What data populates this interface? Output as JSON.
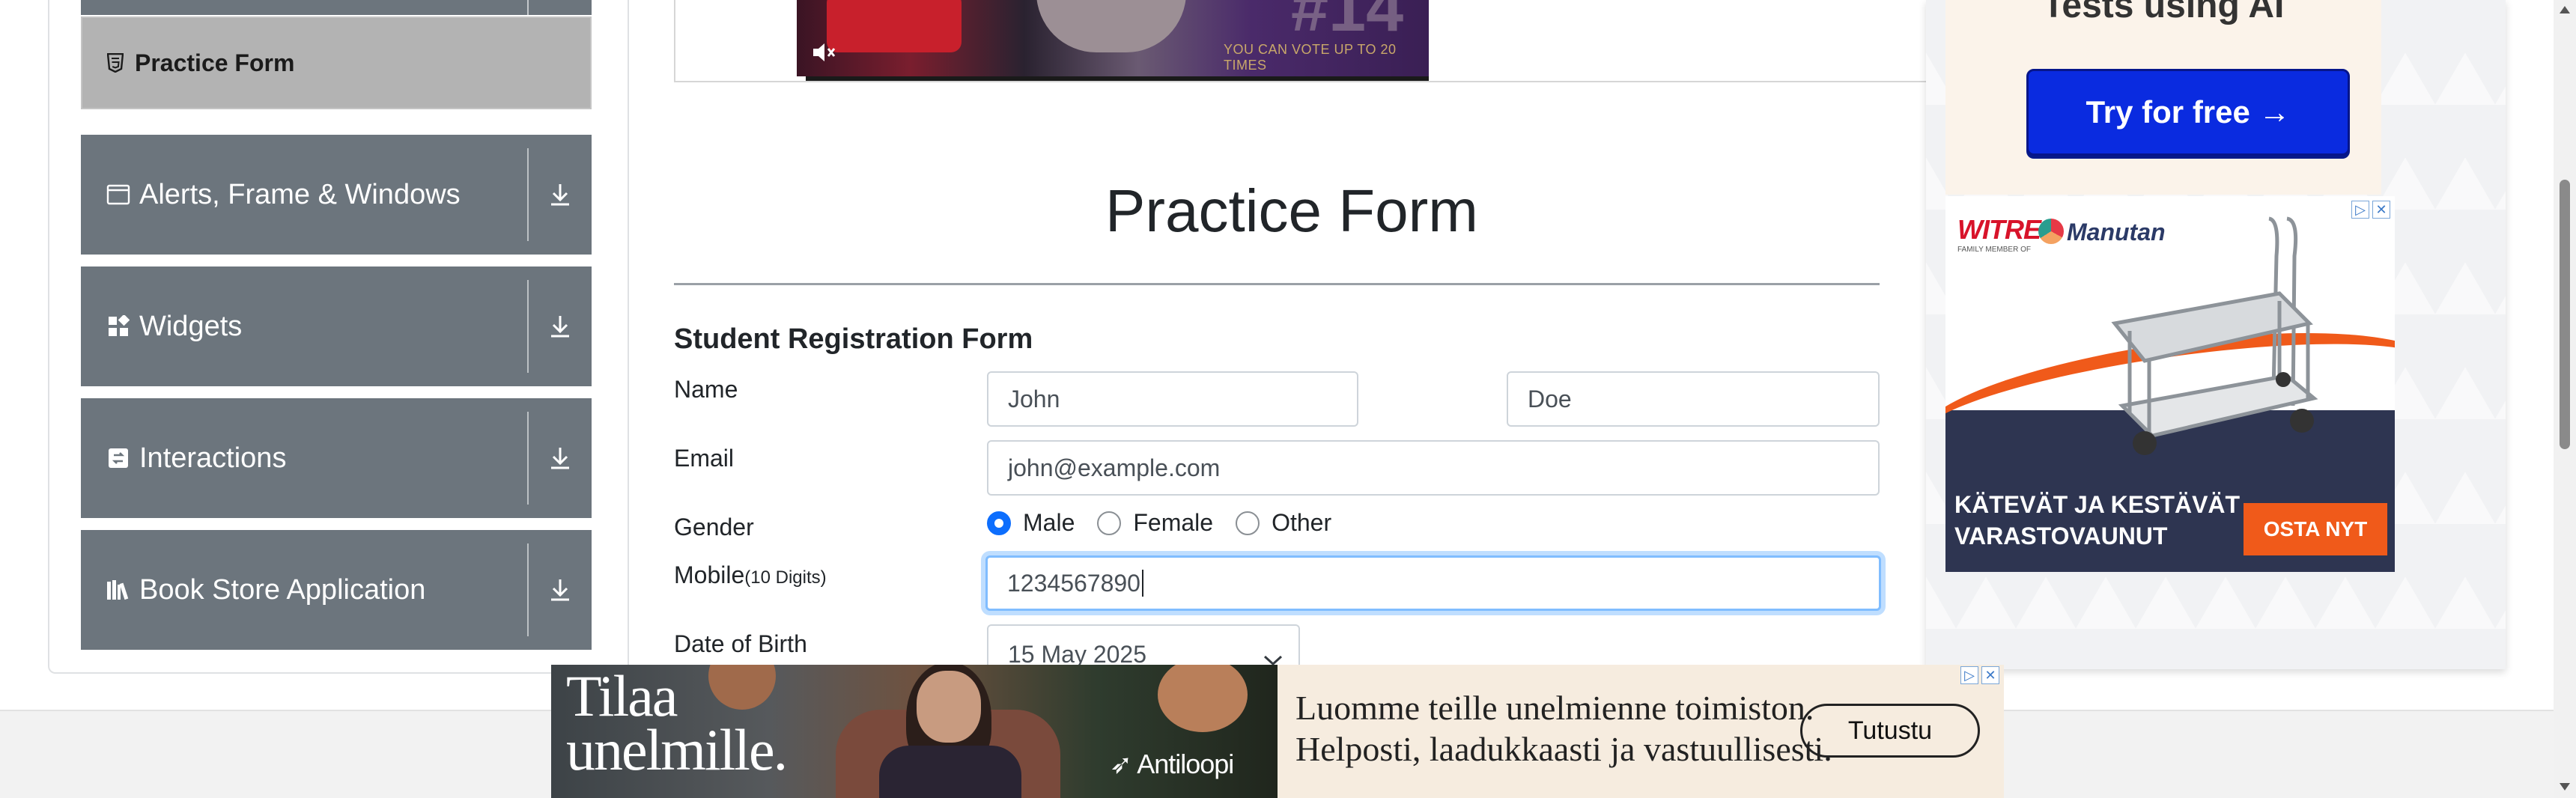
{
  "sidebar": {
    "active_item": "Practice Form",
    "groups": [
      {
        "label": "Alerts, Frame & Windows",
        "icon": "window-icon"
      },
      {
        "label": "Widgets",
        "icon": "widgets-icon"
      },
      {
        "label": "Interactions",
        "icon": "interactions-icon"
      },
      {
        "label": "Book Store Application",
        "icon": "book-store-icon"
      }
    ]
  },
  "video": {
    "overlay_number": "#14",
    "vote_text": "YOU CAN VOTE UP TO 20 TIMES"
  },
  "page": {
    "title": "Practice Form",
    "form_title": "Student Registration Form"
  },
  "form": {
    "name_label": "Name",
    "first_name": "John",
    "last_name": "Doe",
    "email_label": "Email",
    "email": "john@example.com",
    "gender_label": "Gender",
    "gender_options": [
      "Male",
      "Female",
      "Other"
    ],
    "gender_selected": "Male",
    "mobile_label": "Mobile",
    "mobile_hint": "(10 Digits)",
    "mobile": "1234567890",
    "dob_label": "Date of Birth",
    "dob": "15 May 2025"
  },
  "right_ad": {
    "heading": "Tests using AI",
    "button": "Try for free →",
    "brand1": "WITRE",
    "brand1_tag": "FAMILY MEMBER OF",
    "brand2": "Manutan",
    "copy_line1": "KÄTEVÄT JA KESTÄVÄT",
    "copy_line2": "VARASTOVAUNUT",
    "cta": "OSTA NYT"
  },
  "bottom_banner": {
    "headline_line1": "Tilaa",
    "headline_line2": "unelmille.",
    "brand": "Antiloopi",
    "copy_line1": "Luomme teille unelmienne toimiston.",
    "copy_line2": "Helposti, laadukkaasti ja vastuullisesti.",
    "button": "Tutustu"
  },
  "colors": {
    "sidebar_group_bg": "#6c757d",
    "sidebar_active_bg": "#b3b3b3",
    "radio_accent": "#0d6efd",
    "focus_ring": "#80bdff",
    "ad_button": "#0a2be0",
    "ad_cta": "#f05a1a"
  }
}
